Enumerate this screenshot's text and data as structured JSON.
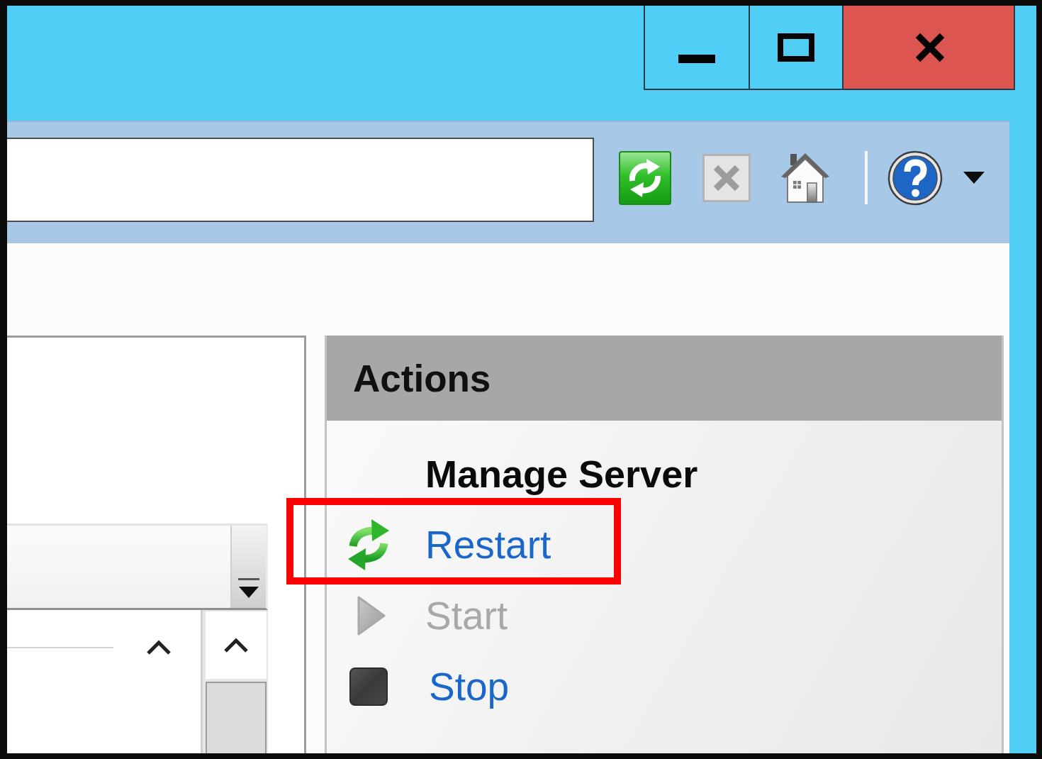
{
  "window": {
    "caption_buttons": [
      {
        "kind": "minimize"
      },
      {
        "kind": "maximize"
      },
      {
        "kind": "close"
      }
    ]
  },
  "toolbar": {
    "buttons": [
      {
        "kind": "refresh",
        "disabled": false
      },
      {
        "kind": "stop",
        "disabled": true
      },
      {
        "kind": "home",
        "disabled": false
      },
      {
        "kind": "separator"
      },
      {
        "kind": "help",
        "disabled": false
      },
      {
        "kind": "dropdown"
      }
    ]
  },
  "actions_panel": {
    "title": "Actions",
    "sections": [
      {
        "heading": "Manage Server",
        "items": [
          {
            "kind": "restart",
            "label": "Restart",
            "disabled": false,
            "highlighted": true
          },
          {
            "kind": "start",
            "label": "Start",
            "disabled": true,
            "highlighted": false
          },
          {
            "kind": "stop",
            "label": "Stop",
            "disabled": false,
            "highlighted": false
          }
        ]
      }
    ]
  }
}
